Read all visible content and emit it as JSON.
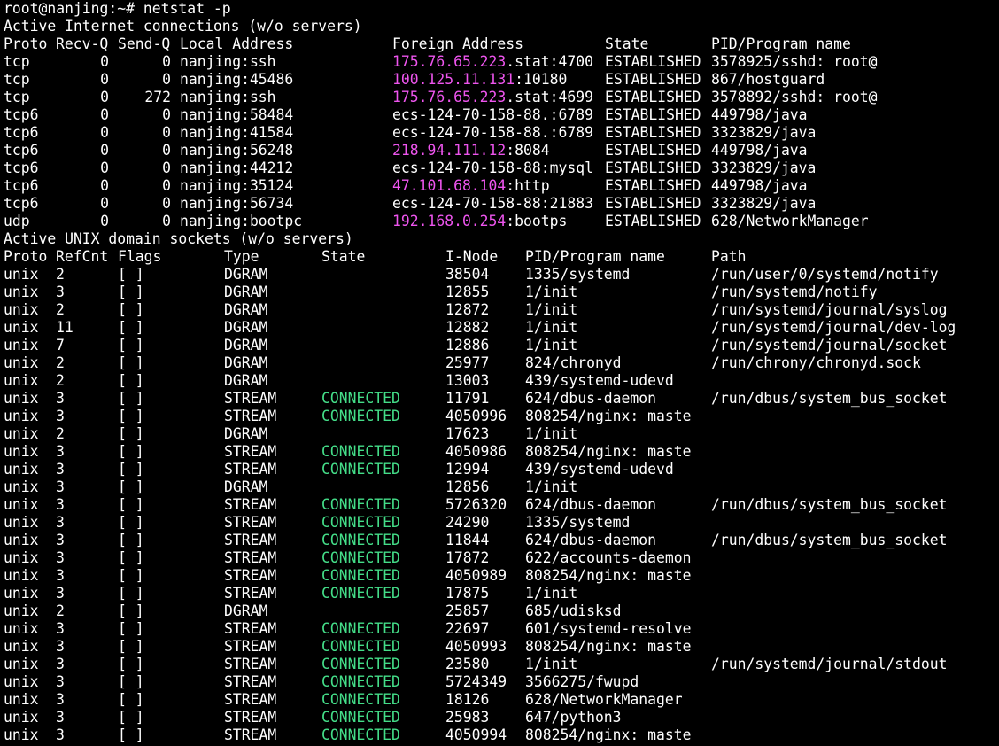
{
  "terminal": {
    "prompt": "root@nanjing:~# netstat -p",
    "inet_heading": "Active Internet connections (w/o servers)",
    "inet_headers": {
      "proto": "Proto",
      "recvq": "Recv-Q",
      "sendq": "Send-Q",
      "local": "Local Address",
      "foreign": "Foreign Address",
      "state": "State",
      "pid": "PID/Program name"
    },
    "inet_rows": [
      {
        "proto": "tcp",
        "recvq": "0",
        "sendq": "0",
        "local": "nanjing:ssh",
        "foreign_host": "175.76.65.223",
        "foreign_rest": ".stat:4700",
        "state": "ESTABLISHED",
        "pid": "3578925/sshd: root@"
      },
      {
        "proto": "tcp",
        "recvq": "0",
        "sendq": "0",
        "local": "nanjing:45486",
        "foreign_host": "100.125.11.131",
        "foreign_rest": ":10180",
        "state": "ESTABLISHED",
        "pid": "867/hostguard"
      },
      {
        "proto": "tcp",
        "recvq": "0",
        "sendq": "272",
        "local": "nanjing:ssh",
        "foreign_host": "175.76.65.223",
        "foreign_rest": ".stat:4699",
        "state": "ESTABLISHED",
        "pid": "3578892/sshd: root@"
      },
      {
        "proto": "tcp6",
        "recvq": "0",
        "sendq": "0",
        "local": "nanjing:58484",
        "foreign_host": "",
        "foreign_rest": "ecs-124-70-158-88.:6789",
        "state": "ESTABLISHED",
        "pid": "449798/java"
      },
      {
        "proto": "tcp6",
        "recvq": "0",
        "sendq": "0",
        "local": "nanjing:41584",
        "foreign_host": "",
        "foreign_rest": "ecs-124-70-158-88.:6789",
        "state": "ESTABLISHED",
        "pid": "3323829/java"
      },
      {
        "proto": "tcp6",
        "recvq": "0",
        "sendq": "0",
        "local": "nanjing:56248",
        "foreign_host": "218.94.111.12",
        "foreign_rest": ":8084",
        "state": "ESTABLISHED",
        "pid": "449798/java"
      },
      {
        "proto": "tcp6",
        "recvq": "0",
        "sendq": "0",
        "local": "nanjing:44212",
        "foreign_host": "",
        "foreign_rest": "ecs-124-70-158-88:mysql",
        "state": "ESTABLISHED",
        "pid": "3323829/java"
      },
      {
        "proto": "tcp6",
        "recvq": "0",
        "sendq": "0",
        "local": "nanjing:35124",
        "foreign_host": "47.101.68.104",
        "foreign_rest": ":http",
        "state": "ESTABLISHED",
        "pid": "449798/java"
      },
      {
        "proto": "tcp6",
        "recvq": "0",
        "sendq": "0",
        "local": "nanjing:56734",
        "foreign_host": "",
        "foreign_rest": "ecs-124-70-158-88:21883",
        "state": "ESTABLISHED",
        "pid": "3323829/java"
      },
      {
        "proto": "udp",
        "recvq": "0",
        "sendq": "0",
        "local": "nanjing:bootpc",
        "foreign_host": "192.168.0.254",
        "foreign_rest": ":bootps",
        "state": "ESTABLISHED",
        "pid": "628/NetworkManager"
      }
    ],
    "unix_heading": "Active UNIX domain sockets (w/o servers)",
    "unix_headers": {
      "proto": "Proto",
      "refcnt": "RefCnt",
      "flags": "Flags",
      "type": "Type",
      "state": "State",
      "inode": "I-Node",
      "pid": "PID/Program name",
      "path": "Path"
    },
    "unix_rows": [
      {
        "proto": "unix",
        "refcnt": "2",
        "flags": "[ ]",
        "type": "DGRAM",
        "state": "",
        "inode": "38504",
        "pid": "1335/systemd",
        "path": "/run/user/0/systemd/notify"
      },
      {
        "proto": "unix",
        "refcnt": "3",
        "flags": "[ ]",
        "type": "DGRAM",
        "state": "",
        "inode": "12855",
        "pid": "1/init",
        "path": "/run/systemd/notify"
      },
      {
        "proto": "unix",
        "refcnt": "2",
        "flags": "[ ]",
        "type": "DGRAM",
        "state": "",
        "inode": "12872",
        "pid": "1/init",
        "path": "/run/systemd/journal/syslog"
      },
      {
        "proto": "unix",
        "refcnt": "11",
        "flags": "[ ]",
        "type": "DGRAM",
        "state": "",
        "inode": "12882",
        "pid": "1/init",
        "path": "/run/systemd/journal/dev-log"
      },
      {
        "proto": "unix",
        "refcnt": "7",
        "flags": "[ ]",
        "type": "DGRAM",
        "state": "",
        "inode": "12886",
        "pid": "1/init",
        "path": "/run/systemd/journal/socket"
      },
      {
        "proto": "unix",
        "refcnt": "2",
        "flags": "[ ]",
        "type": "DGRAM",
        "state": "",
        "inode": "25977",
        "pid": "824/chronyd",
        "path": "/run/chrony/chronyd.sock"
      },
      {
        "proto": "unix",
        "refcnt": "2",
        "flags": "[ ]",
        "type": "DGRAM",
        "state": "",
        "inode": "13003",
        "pid": "439/systemd-udevd",
        "path": ""
      },
      {
        "proto": "unix",
        "refcnt": "3",
        "flags": "[ ]",
        "type": "STREAM",
        "state": "CONNECTED",
        "inode": "11791",
        "pid": "624/dbus-daemon",
        "path": "/run/dbus/system_bus_socket"
      },
      {
        "proto": "unix",
        "refcnt": "3",
        "flags": "[ ]",
        "type": "STREAM",
        "state": "CONNECTED",
        "inode": "4050996",
        "pid": "808254/nginx: maste",
        "path": ""
      },
      {
        "proto": "unix",
        "refcnt": "2",
        "flags": "[ ]",
        "type": "DGRAM",
        "state": "",
        "inode": "17623",
        "pid": "1/init",
        "path": ""
      },
      {
        "proto": "unix",
        "refcnt": "3",
        "flags": "[ ]",
        "type": "STREAM",
        "state": "CONNECTED",
        "inode": "4050986",
        "pid": "808254/nginx: maste",
        "path": ""
      },
      {
        "proto": "unix",
        "refcnt": "3",
        "flags": "[ ]",
        "type": "STREAM",
        "state": "CONNECTED",
        "inode": "12994",
        "pid": "439/systemd-udevd",
        "path": ""
      },
      {
        "proto": "unix",
        "refcnt": "3",
        "flags": "[ ]",
        "type": "DGRAM",
        "state": "",
        "inode": "12856",
        "pid": "1/init",
        "path": ""
      },
      {
        "proto": "unix",
        "refcnt": "3",
        "flags": "[ ]",
        "type": "STREAM",
        "state": "CONNECTED",
        "inode": "5726320",
        "pid": "624/dbus-daemon",
        "path": "/run/dbus/system_bus_socket"
      },
      {
        "proto": "unix",
        "refcnt": "3",
        "flags": "[ ]",
        "type": "STREAM",
        "state": "CONNECTED",
        "inode": "24290",
        "pid": "1335/systemd",
        "path": ""
      },
      {
        "proto": "unix",
        "refcnt": "3",
        "flags": "[ ]",
        "type": "STREAM",
        "state": "CONNECTED",
        "inode": "11844",
        "pid": "624/dbus-daemon",
        "path": "/run/dbus/system_bus_socket"
      },
      {
        "proto": "unix",
        "refcnt": "3",
        "flags": "[ ]",
        "type": "STREAM",
        "state": "CONNECTED",
        "inode": "17872",
        "pid": "622/accounts-daemon",
        "path": ""
      },
      {
        "proto": "unix",
        "refcnt": "3",
        "flags": "[ ]",
        "type": "STREAM",
        "state": "CONNECTED",
        "inode": "4050989",
        "pid": "808254/nginx: maste",
        "path": ""
      },
      {
        "proto": "unix",
        "refcnt": "3",
        "flags": "[ ]",
        "type": "STREAM",
        "state": "CONNECTED",
        "inode": "17875",
        "pid": "1/init",
        "path": ""
      },
      {
        "proto": "unix",
        "refcnt": "2",
        "flags": "[ ]",
        "type": "DGRAM",
        "state": "",
        "inode": "25857",
        "pid": "685/udisksd",
        "path": ""
      },
      {
        "proto": "unix",
        "refcnt": "3",
        "flags": "[ ]",
        "type": "STREAM",
        "state": "CONNECTED",
        "inode": "22697",
        "pid": "601/systemd-resolve",
        "path": ""
      },
      {
        "proto": "unix",
        "refcnt": "3",
        "flags": "[ ]",
        "type": "STREAM",
        "state": "CONNECTED",
        "inode": "4050993",
        "pid": "808254/nginx: maste",
        "path": ""
      },
      {
        "proto": "unix",
        "refcnt": "3",
        "flags": "[ ]",
        "type": "STREAM",
        "state": "CONNECTED",
        "inode": "23580",
        "pid": "1/init",
        "path": "/run/systemd/journal/stdout"
      },
      {
        "proto": "unix",
        "refcnt": "3",
        "flags": "[ ]",
        "type": "STREAM",
        "state": "CONNECTED",
        "inode": "5724349",
        "pid": "3566275/fwupd",
        "path": ""
      },
      {
        "proto": "unix",
        "refcnt": "3",
        "flags": "[ ]",
        "type": "STREAM",
        "state": "CONNECTED",
        "inode": "18126",
        "pid": "628/NetworkManager",
        "path": ""
      },
      {
        "proto": "unix",
        "refcnt": "3",
        "flags": "[ ]",
        "type": "STREAM",
        "state": "CONNECTED",
        "inode": "25983",
        "pid": "647/python3",
        "path": ""
      },
      {
        "proto": "unix",
        "refcnt": "3",
        "flags": "[ ]",
        "type": "STREAM",
        "state": "CONNECTED",
        "inode": "4050994",
        "pid": "808254/nginx: maste",
        "path": ""
      }
    ],
    "colors": {
      "background": "#000000",
      "text": "#ffffff",
      "ip_address": "#ee55ee",
      "connected": "#44dd88"
    }
  }
}
